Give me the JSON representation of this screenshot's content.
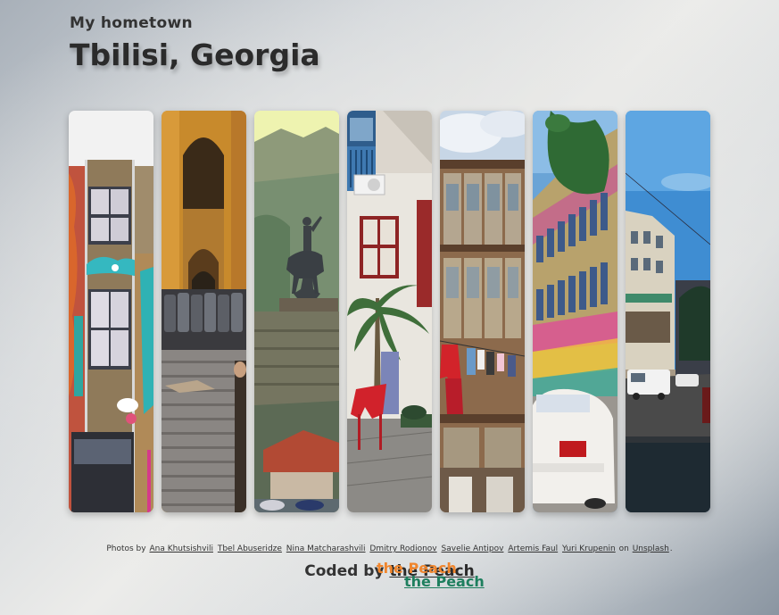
{
  "header": {
    "subtitle": "My hometown",
    "title": "Tbilisi, Georgia"
  },
  "gallery": {
    "photos": [
      {
        "subject": "graffiti-building-photo"
      },
      {
        "subject": "colonnade-police-photo"
      },
      {
        "subject": "statue-fortress-photo"
      },
      {
        "subject": "balcony-courtyard-photo"
      },
      {
        "subject": "wooden-balconies-photo"
      },
      {
        "subject": "colorful-street-photo"
      },
      {
        "subject": "evening-street-photo"
      }
    ]
  },
  "credits": {
    "prefix": "Photos by",
    "photographers": [
      "Ana Khutsishvili",
      "Tbel Abuseridze",
      "Nina Matcharashvili",
      "Dmitry Rodionov",
      "Savelie Antipov",
      "Artemis Faul",
      "Yuri Krupenin"
    ],
    "on_text": "on",
    "platform": "Unsplash",
    "suffix": "."
  },
  "footer": {
    "coded_by": "Coded by",
    "author": "the Peach",
    "ghost_orange": "the Peach",
    "ghost_teal": "the Peach"
  },
  "colors": {
    "orange_accent": "#f0862e",
    "teal_accent": "#1e7f5e"
  }
}
